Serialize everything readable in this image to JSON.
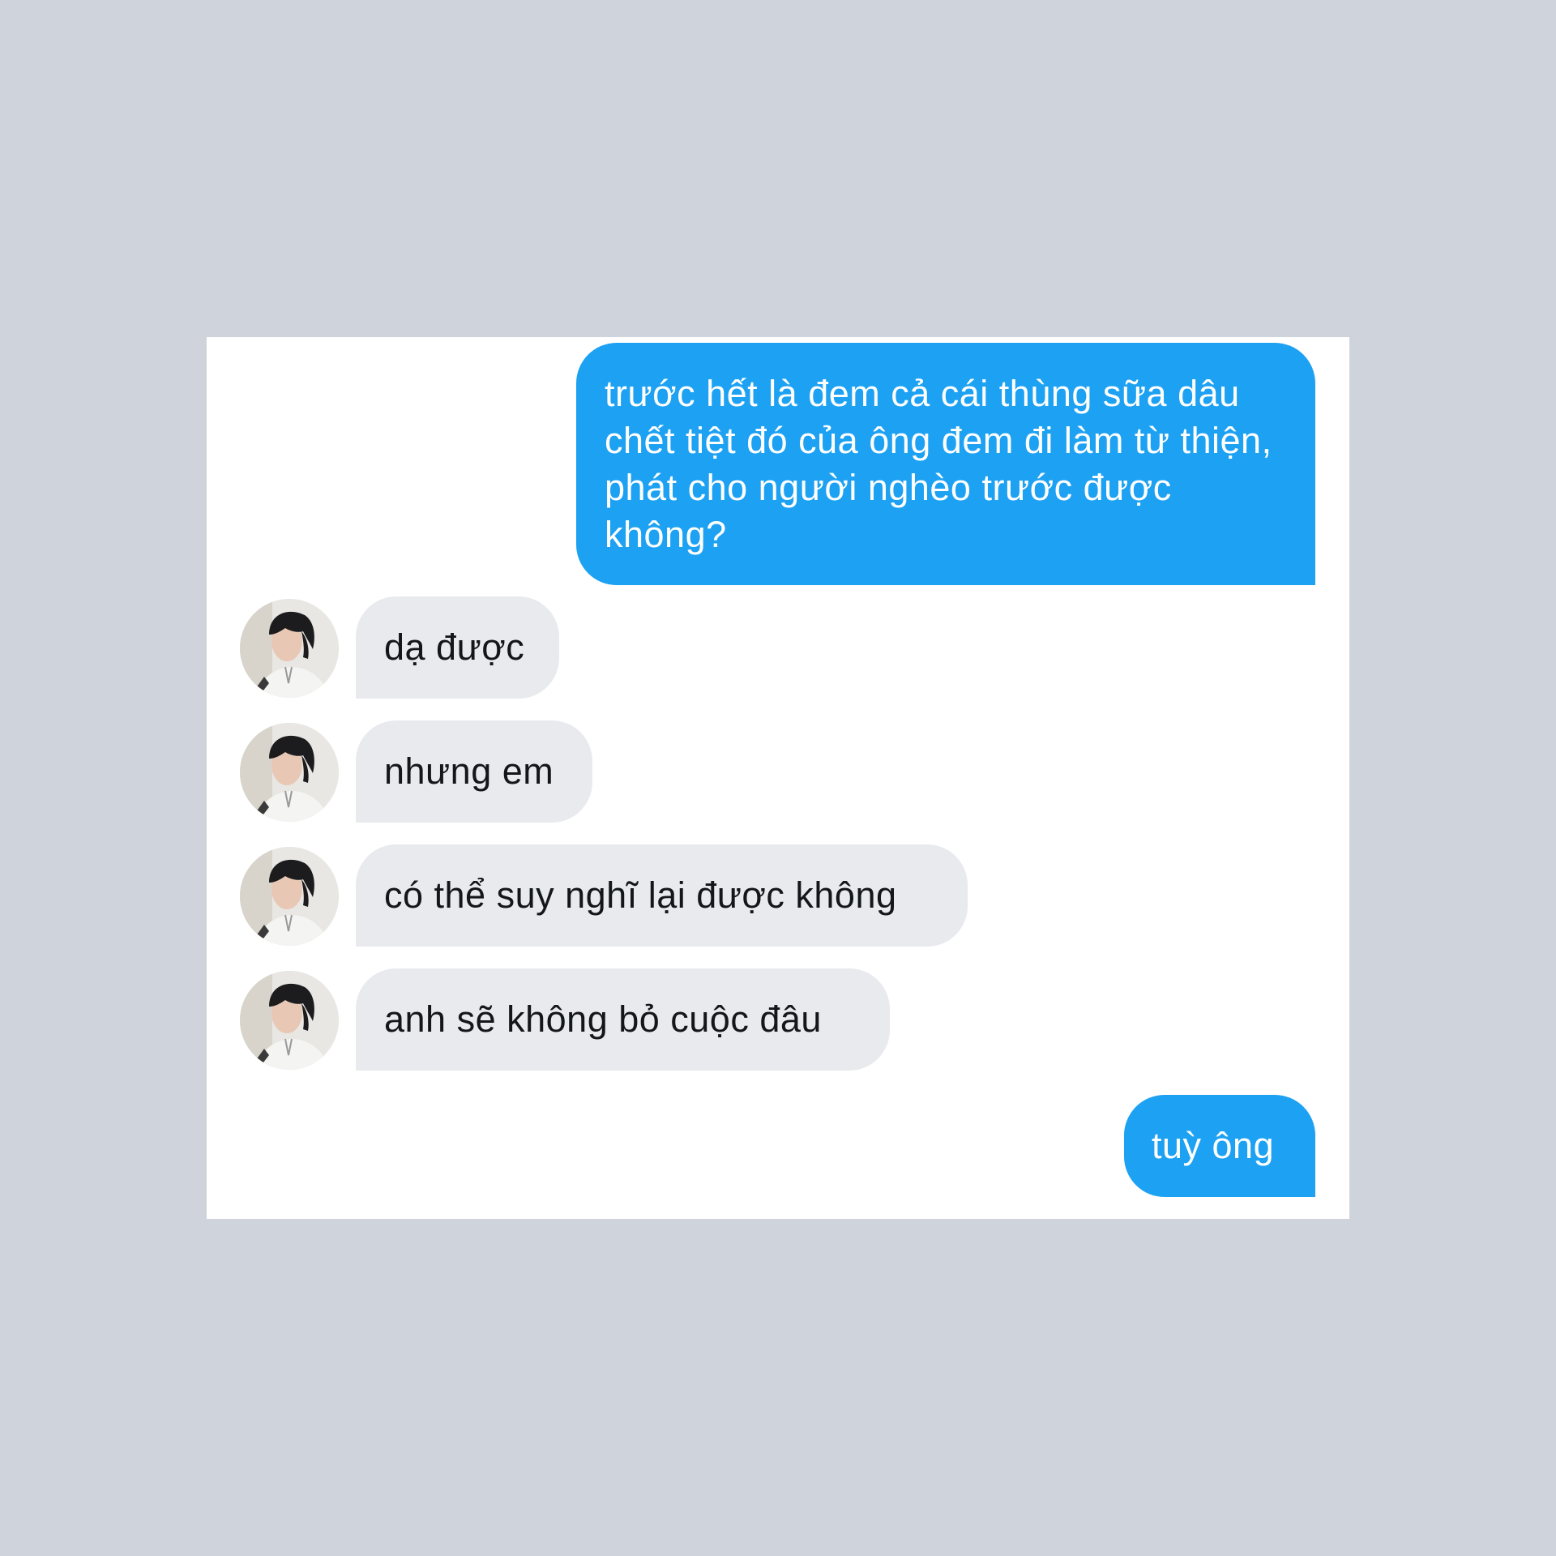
{
  "conversation": {
    "messages": [
      {
        "sender": "me",
        "text": "trước hết là đem cả cái thùng sữa dâu chết tiệt đó của ông đem đi làm từ thiện, phát cho người nghèo trước được không?"
      },
      {
        "sender": "contact",
        "text": "dạ được"
      },
      {
        "sender": "contact",
        "text": "nhưng em"
      },
      {
        "sender": "contact",
        "text": "có thể suy nghĩ lại được không"
      },
      {
        "sender": "contact",
        "text": "anh sẽ không bỏ cuộc đâu"
      },
      {
        "sender": "me",
        "text": "tuỳ ông"
      }
    ]
  },
  "colors": {
    "background": "#cfd3dc",
    "card": "#ffffff",
    "sent_bubble": "#1da1f2",
    "received_bubble": "#e8eaee"
  },
  "icons": {
    "contact_avatar": "contact-profile-photo"
  }
}
